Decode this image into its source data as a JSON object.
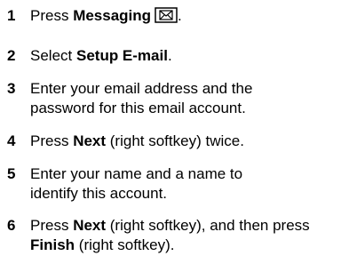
{
  "steps": [
    {
      "number": "1",
      "pre": "Press ",
      "bold": "Messaging",
      "icon": "envelope-icon",
      "post": "."
    },
    {
      "number": "2",
      "pre": "Select ",
      "bold": "Setup E-mail",
      "post": "."
    },
    {
      "number": "3",
      "text": "Enter your email address and the password for this email account."
    },
    {
      "number": "4",
      "pre": "Press ",
      "bold": "Next",
      "post": " (right softkey) twice."
    },
    {
      "number": "5",
      "text": "Enter your name and a name to identify this account."
    },
    {
      "number": "6",
      "pre": "Press ",
      "bold": "Next",
      "mid": " (right softkey), and then press ",
      "bold2": "Finish",
      "post": " (right softkey)."
    }
  ]
}
